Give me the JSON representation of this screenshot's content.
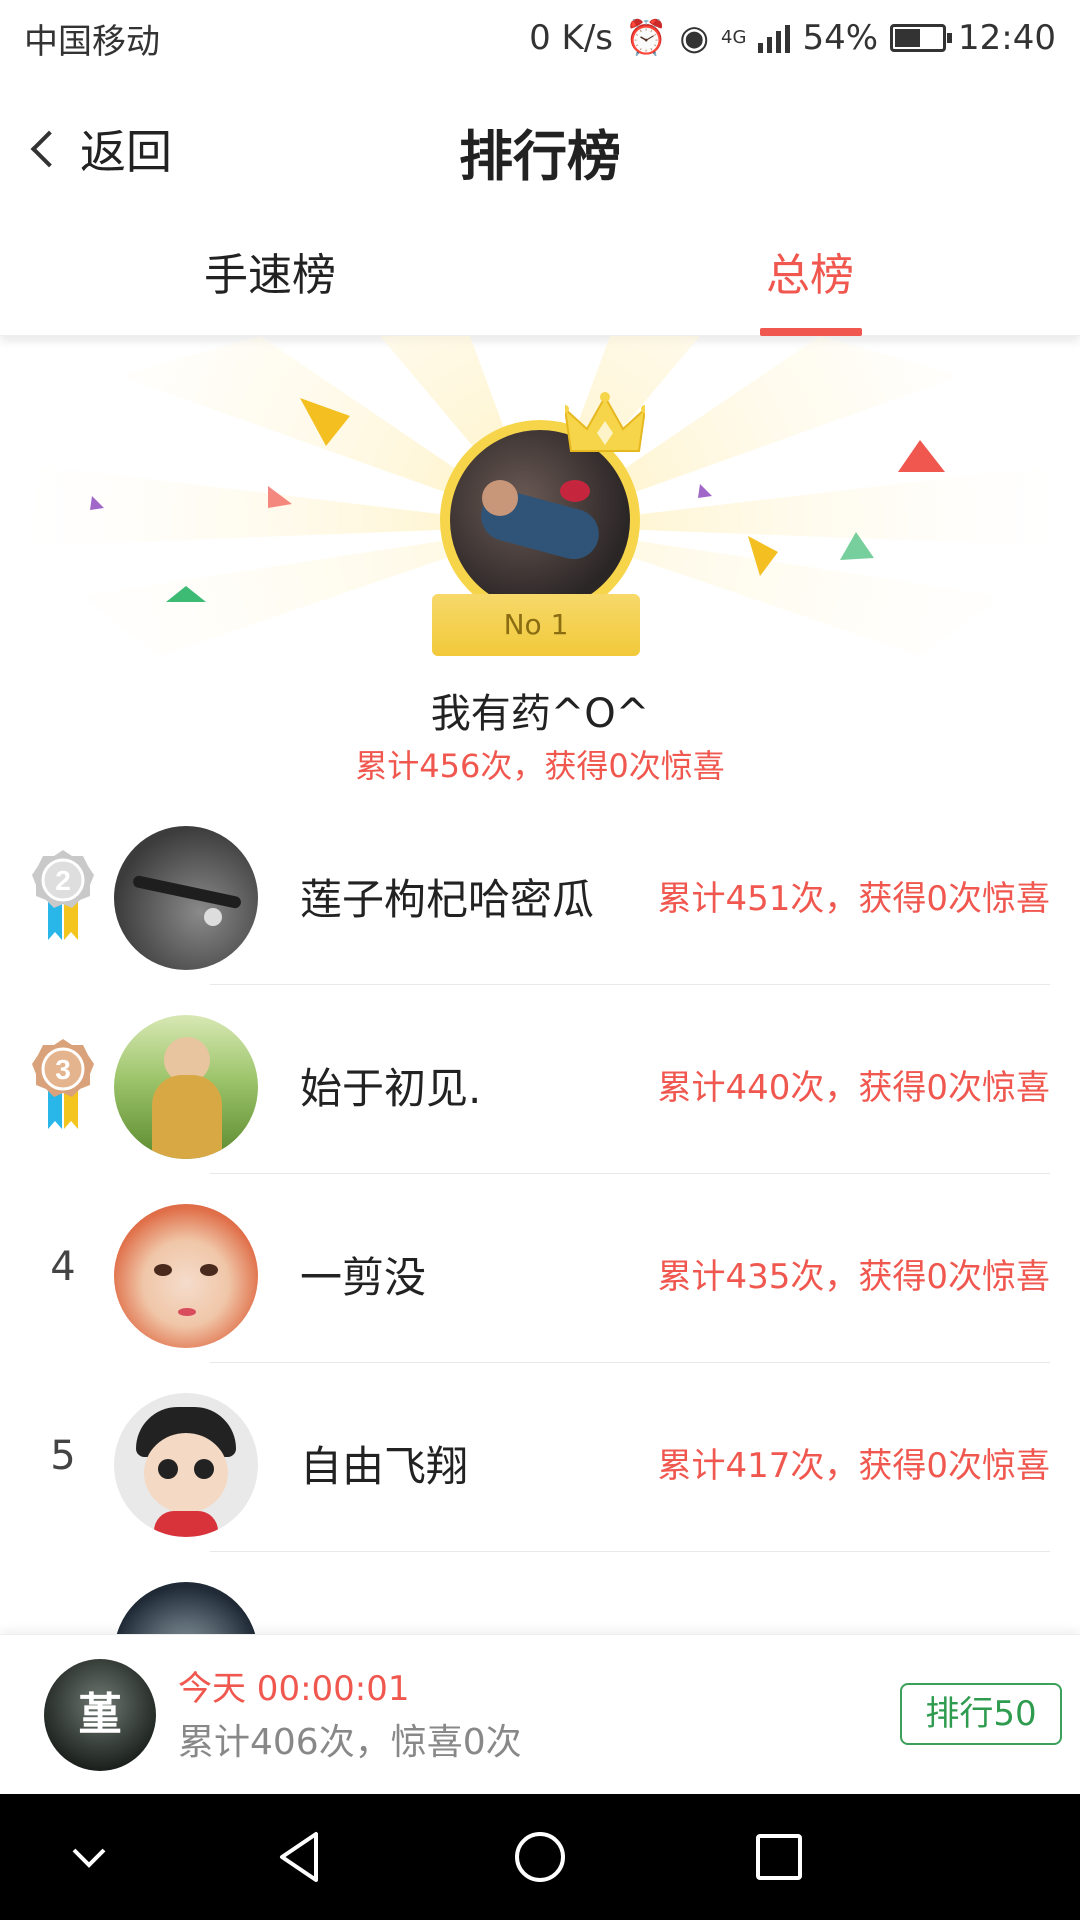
{
  "status_bar": {
    "carrier": "中国移动",
    "net_speed": "0 K/s",
    "network": "4G",
    "battery": "54%",
    "battery_level": 0.54,
    "time": "12:40"
  },
  "header": {
    "back_label": "返回",
    "title": "排行榜"
  },
  "tabs": [
    {
      "label": "手速榜",
      "active": false
    },
    {
      "label": "总榜",
      "active": true
    }
  ],
  "champion": {
    "badge": "No 1",
    "name": "我有药^O^",
    "stats": "累计456次，获得0次惊喜"
  },
  "rankings": [
    {
      "rank": "2",
      "name": "莲子枸杞哈密瓜",
      "stats": "累计451次，获得0次惊喜",
      "medal": "silver"
    },
    {
      "rank": "3",
      "name": "始于初见.",
      "stats": "累计440次，获得0次惊喜",
      "medal": "bronze"
    },
    {
      "rank": "4",
      "name": "一剪没",
      "stats": "累计435次，获得0次惊喜"
    },
    {
      "rank": "5",
      "name": "自由飞翔",
      "stats": "累计417次，获得0次惊喜"
    }
  ],
  "self": {
    "avatar_text": "堇",
    "time": "今天 00:00:01",
    "stats": "累计406次，惊喜0次",
    "rank_button": "排行50"
  },
  "colors": {
    "accent": "#f0574f",
    "green": "#2e9b4f",
    "gold": "#f6d54a"
  },
  "icons": [
    "alarm-icon",
    "eye-icon",
    "signal-icon",
    "battery-icon",
    "back-chevron-icon",
    "crown-icon",
    "medal-silver-icon",
    "medal-bronze-icon",
    "nav-back-icon",
    "nav-home-icon",
    "nav-recents-icon",
    "nav-down-icon"
  ]
}
